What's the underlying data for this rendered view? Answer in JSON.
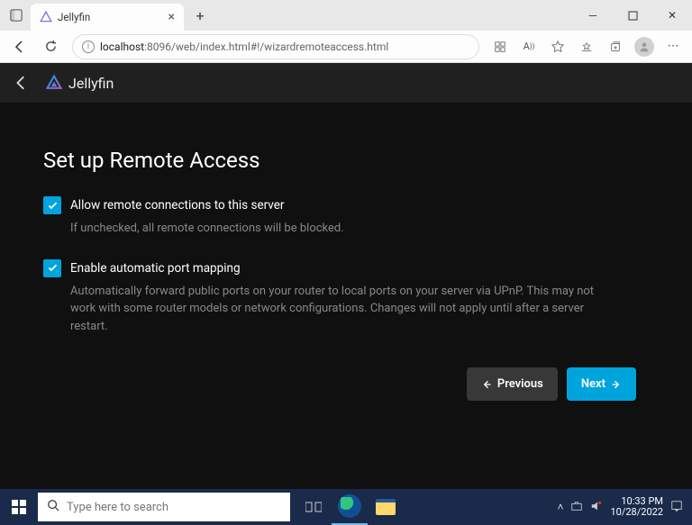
{
  "browser": {
    "tab_title": "Jellyfin",
    "url_host": "localhost",
    "url_path": ":8096/web/index.html#!/wizardremoteaccess.html",
    "new_tab": "+"
  },
  "app": {
    "brand": "Jellyfin",
    "page_title": "Set up Remote Access",
    "settings": {
      "remote": {
        "label": "Allow remote connections to this server",
        "desc": "If unchecked, all remote connections will be blocked.",
        "checked": true
      },
      "upnp": {
        "label": "Enable automatic port mapping",
        "desc": "Automatically forward public ports on your router to local ports on your server via UPnP. This may not work with some router models or network configurations. Changes will not apply until after a server restart.",
        "checked": true
      }
    },
    "buttons": {
      "previous": "Previous",
      "next": "Next"
    }
  },
  "taskbar": {
    "search_placeholder": "Type here to search",
    "time": "10:33 PM",
    "date": "10/28/2022"
  }
}
